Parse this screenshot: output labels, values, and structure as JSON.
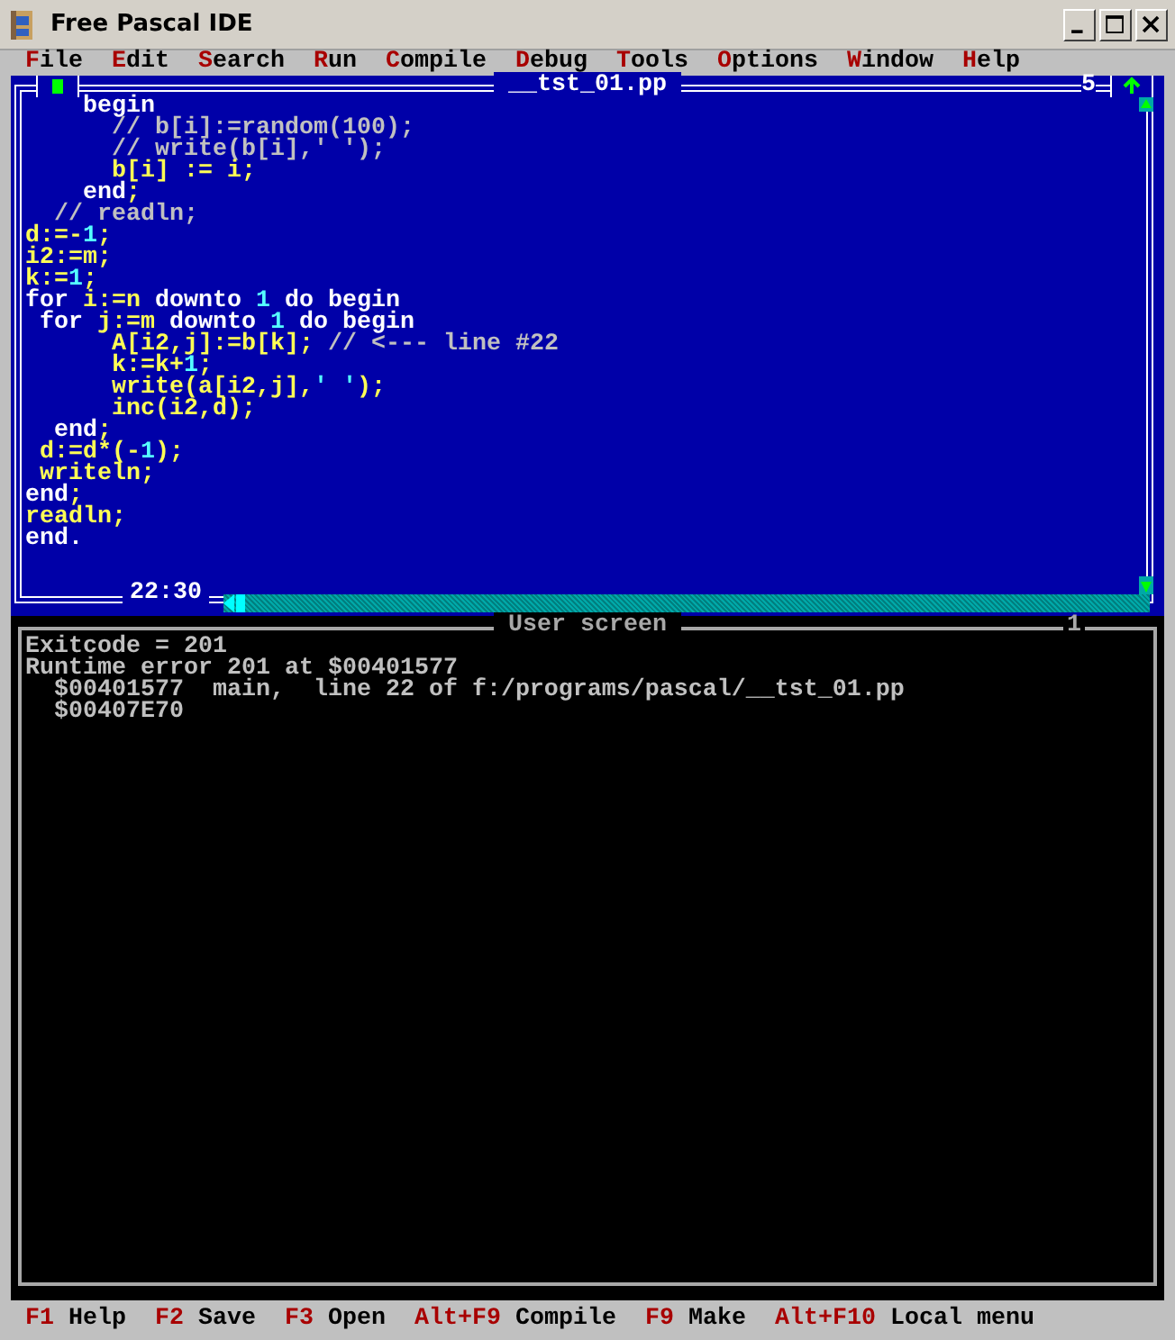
{
  "window": {
    "title": "Free Pascal IDE"
  },
  "menu": [
    "File",
    "Edit",
    "Search",
    "Run",
    "Compile",
    "Debug",
    "Tools",
    "Options",
    "Window",
    "Help"
  ],
  "editor": {
    "title": "__tst_01.pp",
    "window_number": "5",
    "cursor_position": "22:30",
    "lines": [
      [
        {
          "kind": "keyword",
          "text": "    begin"
        }
      ],
      [
        {
          "kind": "comment",
          "text": "      // b[i]:=random(100);"
        }
      ],
      [
        {
          "kind": "comment",
          "text": "      // write(b[i],' ');"
        }
      ],
      [
        {
          "kind": "code",
          "text": "      b[i] := i;"
        }
      ],
      [
        {
          "kind": "keyword",
          "text": "    end"
        },
        {
          "kind": "code",
          "text": ";"
        }
      ],
      [
        {
          "kind": "comment",
          "text": "  // readln;"
        }
      ],
      [
        {
          "kind": "code",
          "text": "d:=-"
        },
        {
          "kind": "number",
          "text": "1"
        },
        {
          "kind": "code",
          "text": ";"
        }
      ],
      [
        {
          "kind": "code",
          "text": "i2:=m;"
        }
      ],
      [
        {
          "kind": "code",
          "text": "k:="
        },
        {
          "kind": "number",
          "text": "1"
        },
        {
          "kind": "code",
          "text": ";"
        }
      ],
      [
        {
          "kind": "keyword",
          "text": "for"
        },
        {
          "kind": "code",
          "text": " i:=n "
        },
        {
          "kind": "keyword",
          "text": "downto"
        },
        {
          "kind": "number",
          "text": " 1 "
        },
        {
          "kind": "keyword",
          "text": "do begin"
        }
      ],
      [
        {
          "kind": "keyword",
          "text": " for"
        },
        {
          "kind": "code",
          "text": " j:=m "
        },
        {
          "kind": "keyword",
          "text": "downto"
        },
        {
          "kind": "number",
          "text": " 1 "
        },
        {
          "kind": "keyword",
          "text": "do begin"
        }
      ],
      [
        {
          "kind": "code",
          "text": "      A[i2,j]:=b[k]; "
        },
        {
          "kind": "comment",
          "text": "// <--- line #22"
        }
      ],
      [
        {
          "kind": "code",
          "text": "      k:=k+"
        },
        {
          "kind": "number",
          "text": "1"
        },
        {
          "kind": "code",
          "text": ";"
        }
      ],
      [
        {
          "kind": "code",
          "text": "      write(a[i2,j],"
        },
        {
          "kind": "string",
          "text": "' '"
        },
        {
          "kind": "code",
          "text": ");"
        }
      ],
      [
        {
          "kind": "code",
          "text": "      inc(i2,d);"
        }
      ],
      [
        {
          "kind": "keyword",
          "text": "  end"
        },
        {
          "kind": "code",
          "text": ";"
        }
      ],
      [
        {
          "kind": "code",
          "text": " d:=d*(-"
        },
        {
          "kind": "number",
          "text": "1"
        },
        {
          "kind": "code",
          "text": ");"
        }
      ],
      [
        {
          "kind": "code",
          "text": " writeln;"
        }
      ],
      [
        {
          "kind": "keyword",
          "text": "end"
        },
        {
          "kind": "code",
          "text": ";"
        }
      ],
      [
        {
          "kind": "code",
          "text": "readln;"
        }
      ],
      [
        {
          "kind": "keyword",
          "text": "end."
        }
      ]
    ]
  },
  "user_screen": {
    "title": "User screen",
    "window_number": "1",
    "lines": [
      "Exitcode = 201",
      "Runtime error 201 at $00401577",
      "  $00401577  main,  line 22 of f:/programs/pascal/__tst_01.pp",
      "  $00407E70"
    ]
  },
  "status_bar": [
    {
      "key": "F1",
      "label": "Help"
    },
    {
      "key": "F2",
      "label": "Save"
    },
    {
      "key": "F3",
      "label": "Open"
    },
    {
      "key": "Alt+F9",
      "label": "Compile"
    },
    {
      "key": "F9",
      "label": "Make"
    },
    {
      "key": "Alt+F10",
      "label": "Local menu"
    }
  ]
}
